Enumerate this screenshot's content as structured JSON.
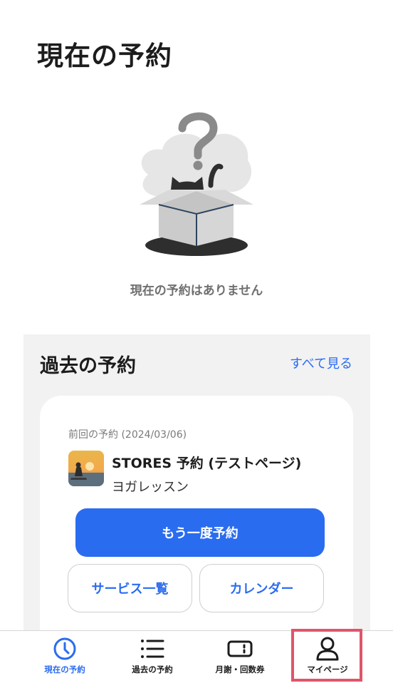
{
  "header": {
    "title": "現在の予約"
  },
  "current": {
    "empty_message": "現在の予約はありません"
  },
  "past": {
    "title": "過去の予約",
    "see_all_label": "すべて見る",
    "card": {
      "previous_label": "前回の予約 (2024/03/06)",
      "shop_name": "STORES 予約 (テストページ)",
      "service_name": "ヨガレッスン",
      "rebook_label": "もう一度予約",
      "service_list_label": "サービス一覧",
      "calendar_label": "カレンダー"
    }
  },
  "tabs": [
    {
      "label": "現在の予約",
      "icon": "clock-icon",
      "active": true
    },
    {
      "label": "過去の予約",
      "icon": "list-icon",
      "active": false
    },
    {
      "label": "月謝・回数券",
      "icon": "ticket-icon",
      "active": false
    },
    {
      "label": "マイページ",
      "icon": "person-icon",
      "active": false
    }
  ],
  "colors": {
    "accent": "#2a6cf0",
    "highlight": "#e0556a"
  }
}
